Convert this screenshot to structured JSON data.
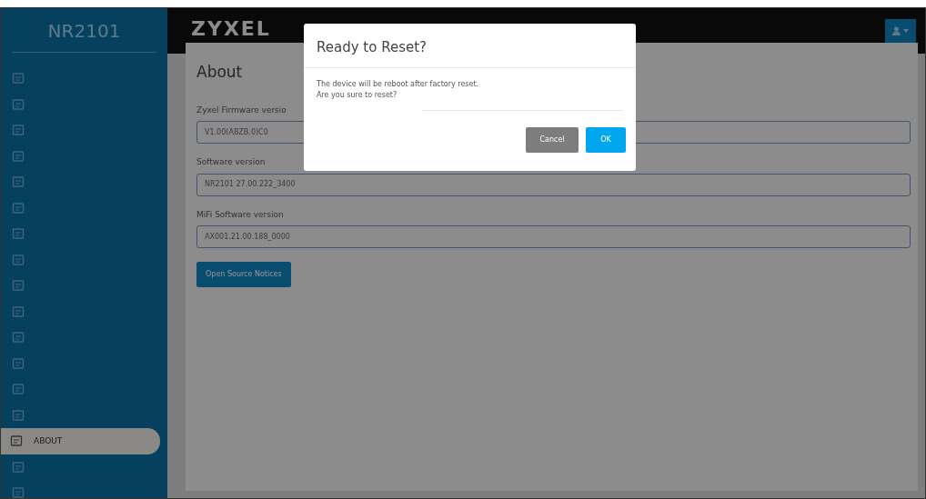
{
  "sidebar": {
    "title": "NR2101",
    "items": [
      {
        "selected": false
      },
      {
        "selected": false
      },
      {
        "selected": false
      },
      {
        "selected": false
      },
      {
        "selected": false
      },
      {
        "selected": false
      },
      {
        "selected": false
      },
      {
        "selected": false
      },
      {
        "selected": false
      },
      {
        "selected": false
      },
      {
        "selected": false
      },
      {
        "selected": false
      },
      {
        "selected": false
      },
      {
        "selected": false
      },
      {
        "label": "ABOUT",
        "selected": true
      },
      {
        "selected": false
      },
      {
        "selected": false
      }
    ]
  },
  "header": {
    "logo": "ZYXEL"
  },
  "page": {
    "title": "About",
    "fields": [
      {
        "label": "Zyxel Firmware versio",
        "value": "V1.00(ABZB.0)C0"
      },
      {
        "label": "Software version",
        "value": "NR2101 27.00.222_3400"
      },
      {
        "label": "MiFi Software version",
        "value": "AX001.21.00.188_0000"
      }
    ],
    "button": "Open Source Notices"
  },
  "dialog": {
    "title": "Ready to Reset?",
    "message": [
      "The device will be reboot after factory reset.",
      "Are you sure to reset?"
    ],
    "buttons": [
      {
        "label": "Cancel",
        "kind": "secondary"
      },
      {
        "label": "OK",
        "kind": "primary"
      }
    ]
  }
}
